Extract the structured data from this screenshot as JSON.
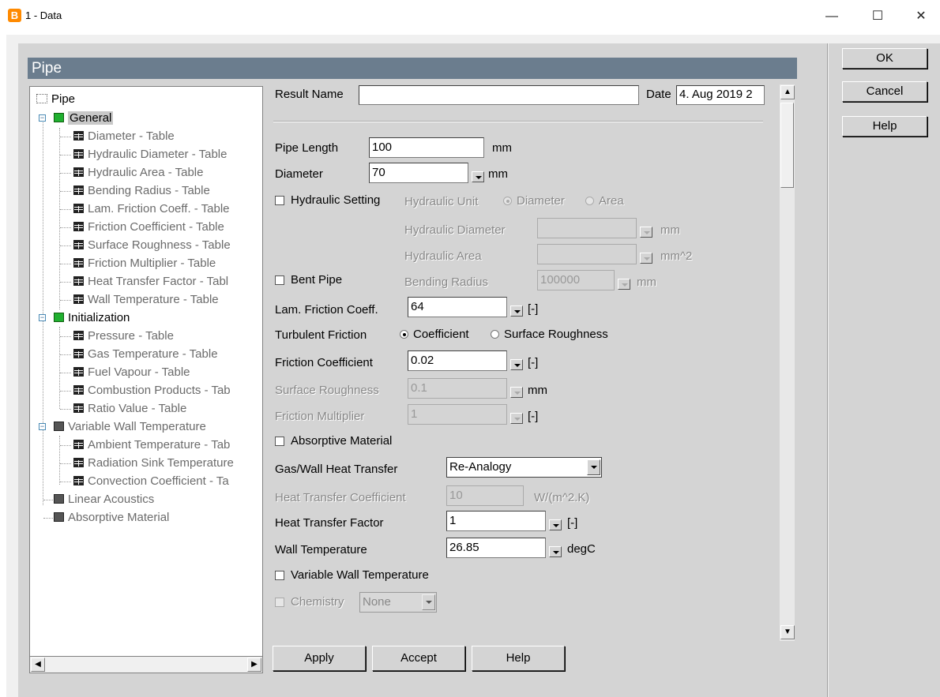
{
  "window": {
    "icon_letter": "B",
    "title": "1 - Data",
    "minimize": "—",
    "maximize": "☐",
    "close": "✕"
  },
  "header": {
    "title": "Pipe"
  },
  "side_buttons": {
    "ok": "OK",
    "cancel": "Cancel",
    "help": "Help"
  },
  "tree": {
    "root": "Pipe",
    "general": "General",
    "general_items": [
      "Diameter - Table",
      "Hydraulic Diameter - Table",
      "Hydraulic Area - Table",
      "Bending Radius - Table",
      "Lam. Friction Coeff. - Table",
      "Friction Coefficient - Table",
      "Surface Roughness - Table",
      "Friction Multiplier - Table",
      "Heat Transfer Factor - Tabl",
      "Wall Temperature - Table"
    ],
    "initialization": "Initialization",
    "initialization_items": [
      "Pressure - Table",
      "Gas Temperature - Table",
      "Fuel Vapour - Table",
      "Combustion Products - Tab",
      "Ratio Value - Table"
    ],
    "variable_wall": "Variable Wall Temperature",
    "variable_wall_items": [
      "Ambient Temperature - Tab",
      "Radiation Sink Temperature",
      "Convection Coefficient - Ta"
    ],
    "linear_acoustics": "Linear Acoustics",
    "absorptive_material": "Absorptive Material"
  },
  "form": {
    "result_name_label": "Result Name",
    "result_name_value": "",
    "date_label": "Date",
    "date_value": "4. Aug 2019 2",
    "pipe_length_label": "Pipe Length",
    "pipe_length_value": "100",
    "pipe_length_unit": "mm",
    "diameter_label": "Diameter",
    "diameter_value": "70",
    "diameter_unit": "mm",
    "hydraulic_setting_label": "Hydraulic Setting",
    "hydraulic_unit_label": "Hydraulic Unit",
    "hydraulic_unit_options": [
      "Diameter",
      "Area"
    ],
    "hydraulic_diameter_label": "Hydraulic Diameter",
    "hydraulic_diameter_value": "",
    "hydraulic_diameter_unit": "mm",
    "hydraulic_area_label": "Hydraulic Area",
    "hydraulic_area_value": "",
    "hydraulic_area_unit": "mm^2",
    "bent_pipe_label": "Bent Pipe",
    "bending_radius_label": "Bending Radius",
    "bending_radius_value": "100000",
    "bending_radius_unit": "mm",
    "lam_friction_label": "Lam. Friction Coeff.",
    "lam_friction_value": "64",
    "lam_friction_unit": "[-]",
    "turbulent_friction_label": "Turbulent Friction",
    "turbulent_options": [
      "Coefficient",
      "Surface Roughness"
    ],
    "friction_coefficient_label": "Friction Coefficient",
    "friction_coefficient_value": "0.02",
    "friction_coefficient_unit": "[-]",
    "surface_roughness_label": "Surface Roughness",
    "surface_roughness_value": "0.1",
    "surface_roughness_unit": "mm",
    "friction_multiplier_label": "Friction Multiplier",
    "friction_multiplier_value": "1",
    "friction_multiplier_unit": "[-]",
    "absorptive_material_label": "Absorptive Material",
    "gas_wall_label": "Gas/Wall Heat Transfer",
    "gas_wall_value": "Re-Analogy",
    "htc_label": "Heat Transfer Coefficient",
    "htc_value": "10",
    "htc_unit": "W/(m^2.K)",
    "htf_label": "Heat Transfer Factor",
    "htf_value": "1",
    "htf_unit": "[-]",
    "wall_temp_label": "Wall Temperature",
    "wall_temp_value": "26.85",
    "wall_temp_unit": "degC",
    "variable_wall_label": "Variable Wall Temperature",
    "chemistry_label": "Chemistry",
    "chemistry_value": "None"
  },
  "bottom_buttons": {
    "apply": "Apply",
    "accept": "Accept",
    "help": "Help"
  }
}
